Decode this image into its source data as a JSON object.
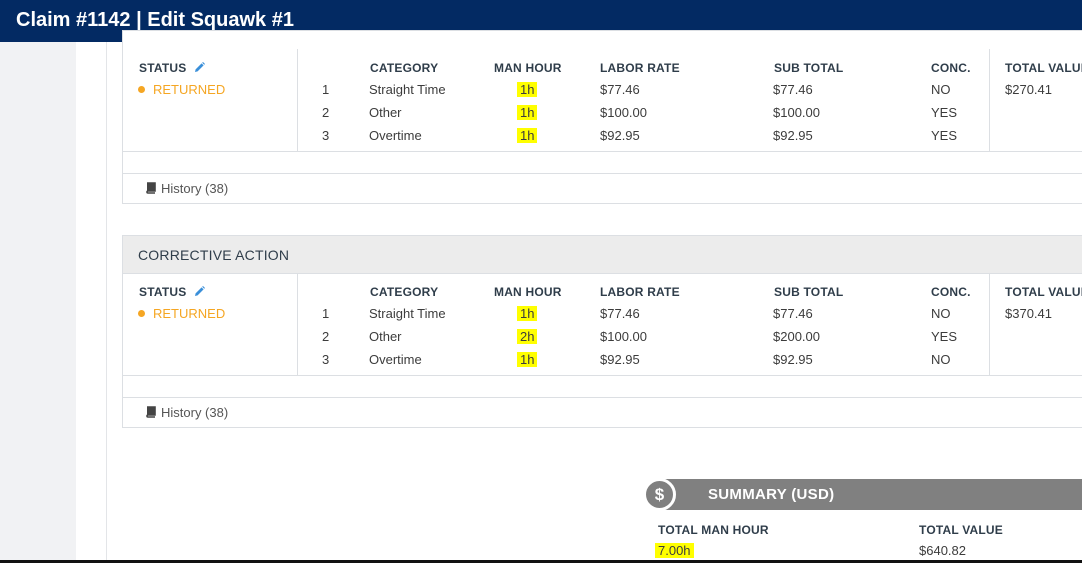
{
  "window": {
    "title": "Claim #1142 | Edit Squawk #1"
  },
  "columns": {
    "status": "STATUS",
    "category": "CATEGORY",
    "man_hour": "MAN HOUR",
    "labor_rate": "LABOR RATE",
    "sub_total": "SUB TOTAL",
    "conc": "CONC.",
    "total_value": "TOTAL VALUE"
  },
  "section1": {
    "status": "RETURNED",
    "total_value": "$270.41",
    "rows": [
      {
        "num": "1",
        "category": "Straight Time",
        "man_hour": "1h",
        "labor_rate": "$77.46",
        "sub_total": "$77.46",
        "conc": "NO"
      },
      {
        "num": "2",
        "category": "Other",
        "man_hour": "1h",
        "labor_rate": "$100.00",
        "sub_total": "$100.00",
        "conc": "YES"
      },
      {
        "num": "3",
        "category": "Overtime",
        "man_hour": "1h",
        "labor_rate": "$92.95",
        "sub_total": "$92.95",
        "conc": "YES"
      }
    ],
    "history": "History (38)"
  },
  "section2": {
    "title": "CORRECTIVE ACTION",
    "status": "RETURNED",
    "total_value": "$370.41",
    "rows": [
      {
        "num": "1",
        "category": "Straight Time",
        "man_hour": "1h",
        "labor_rate": "$77.46",
        "sub_total": "$77.46",
        "conc": "NO"
      },
      {
        "num": "2",
        "category": "Other",
        "man_hour": "2h",
        "labor_rate": "$100.00",
        "sub_total": "$200.00",
        "conc": "YES"
      },
      {
        "num": "3",
        "category": "Overtime",
        "man_hour": "1h",
        "labor_rate": "$92.95",
        "sub_total": "$92.95",
        "conc": "NO"
      }
    ],
    "history": "History (38)"
  },
  "summary": {
    "title": "SUMMARY (USD)",
    "icon_glyph": "$",
    "total_man_hour_label": "TOTAL MAN HOUR",
    "total_man_hour": "7.00h",
    "total_value_label": "TOTAL VALUE",
    "total_value": "$640.82"
  },
  "colors": {
    "header_bg": "#032a63",
    "status_returned": "#f5a623",
    "highlight": "#ffff00",
    "summary_bar": "#808080"
  }
}
